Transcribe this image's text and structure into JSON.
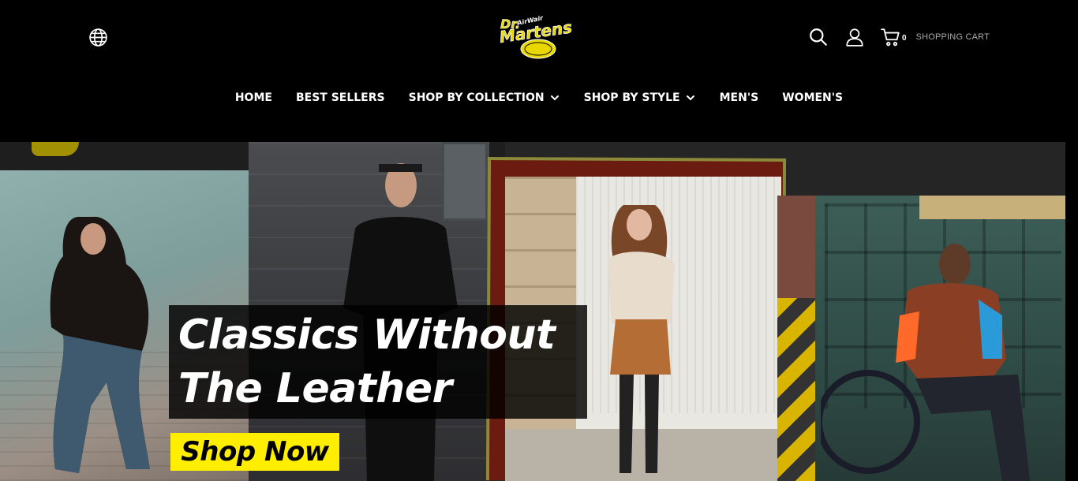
{
  "header": {
    "logo_text_top": "Dr.",
    "logo_text_main": "Martens",
    "logo_text_air": "AirWair",
    "cart_count": "0",
    "cart_label": "SHOPPING CART",
    "icons": {
      "globe": "globe-icon",
      "search": "search-icon",
      "account": "user-icon",
      "cart": "cart-icon"
    }
  },
  "nav": {
    "items": [
      {
        "label": "HOME",
        "has_dropdown": false
      },
      {
        "label": "BEST SELLERS",
        "has_dropdown": false
      },
      {
        "label": "SHOP BY COLLECTION",
        "has_dropdown": true
      },
      {
        "label": "SHOP BY STYLE",
        "has_dropdown": true
      },
      {
        "label": "MEN'S",
        "has_dropdown": false
      },
      {
        "label": "WOMEN'S",
        "has_dropdown": false
      }
    ]
  },
  "hero": {
    "headline_line1": "Classics Without",
    "headline_line2": "The Leather",
    "cta_label": "Shop Now",
    "colors": {
      "cta_background": "#ffee00",
      "headline_box": "#000000",
      "page_background": "#000000"
    }
  }
}
